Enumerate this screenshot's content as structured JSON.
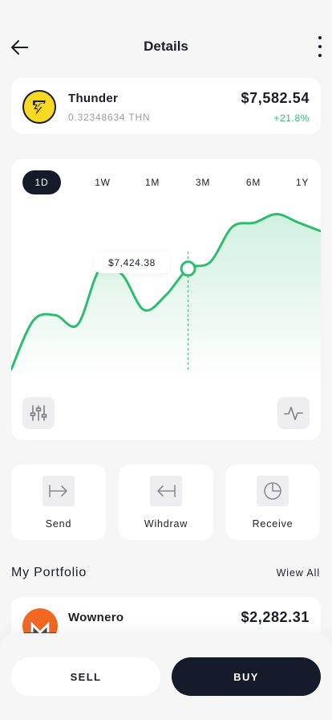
{
  "header": {
    "title": "Details",
    "back_icon": "arrow-left-icon",
    "more_icon": "more-vertical-icon"
  },
  "coin": {
    "name": "Thunder",
    "amount": "0.32348634 THN",
    "price": "$7,582.54",
    "change": "+21.8%",
    "logo_icon": "thunder-coin-icon",
    "logo_color": "#f7d924",
    "change_color": "#2dbd6e"
  },
  "chart": {
    "tabs": [
      {
        "label": "1D",
        "active": true
      },
      {
        "label": "1W",
        "active": false
      },
      {
        "label": "1M",
        "active": false
      },
      {
        "label": "3M",
        "active": false
      },
      {
        "label": "6M",
        "active": false
      },
      {
        "label": "1Y",
        "active": false
      }
    ],
    "tooltip_value": "$7,424.38",
    "line_color": "#2dbd6e",
    "left_button_icon": "sliders-icon",
    "right_button_icon": "activity-icon"
  },
  "chart_data": {
    "type": "area",
    "title": "",
    "xlabel": "",
    "ylabel": "",
    "series": [
      {
        "values": [
          6950,
          7180,
          7205,
          7160,
          7420,
          7398,
          7230,
          7300,
          7424,
          7455,
          7620,
          7640,
          7680,
          7640,
          7600
        ]
      }
    ],
    "highlight": {
      "index": 8,
      "value": 7424.38
    },
    "ylim": [
      6900,
      7750
    ],
    "grid": false,
    "legend": "none"
  },
  "actions": [
    {
      "label": "Send",
      "icon": "send-arrow-icon"
    },
    {
      "label": "Wihdraw",
      "icon": "withdraw-arrow-icon"
    },
    {
      "label": "Receive",
      "icon": "pie-chart-icon"
    }
  ],
  "portfolio": {
    "title": "My Portfolio",
    "view_all": "Wiew All",
    "items": [
      {
        "name": "Wownero",
        "price": "$2,282.31",
        "logo_icon": "monero-coin-icon",
        "logo_color": "#f26822"
      }
    ]
  },
  "footer": {
    "sell_label": "SELL",
    "buy_label": "BUY"
  }
}
